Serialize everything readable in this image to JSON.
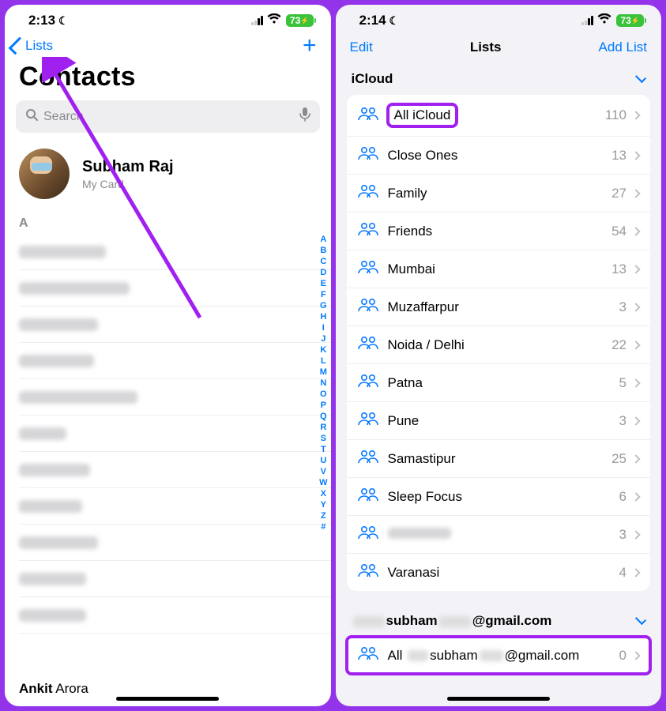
{
  "left": {
    "status": {
      "time": "2:13",
      "battery": "73"
    },
    "nav": {
      "back": "Lists"
    },
    "title": "Contacts",
    "search": {
      "placeholder": "Search"
    },
    "mycard": {
      "name": "Subham Raj",
      "sub": "My Card"
    },
    "section_letter": "A",
    "index": [
      "A",
      "B",
      "C",
      "D",
      "E",
      "F",
      "G",
      "H",
      "I",
      "J",
      "K",
      "L",
      "M",
      "N",
      "O",
      "P",
      "Q",
      "R",
      "S",
      "T",
      "U",
      "V",
      "W",
      "X",
      "Y",
      "Z",
      "#"
    ],
    "bottom_contact": {
      "first": "Ankit",
      "last": "Arora"
    }
  },
  "right": {
    "status": {
      "time": "2:14",
      "battery": "73"
    },
    "nav": {
      "edit": "Edit",
      "title": "Lists",
      "add": "Add List"
    },
    "sections": {
      "icloud": {
        "header": "iCloud",
        "rows": [
          {
            "label": "All iCloud",
            "count": "110",
            "highlight": true
          },
          {
            "label": "Close Ones",
            "count": "13"
          },
          {
            "label": "Family",
            "count": "27"
          },
          {
            "label": "Friends",
            "count": "54"
          },
          {
            "label": "Mumbai",
            "count": "13"
          },
          {
            "label": "Muzaffarpur",
            "count": "3"
          },
          {
            "label": "Noida / Delhi",
            "count": "22"
          },
          {
            "label": "Patna",
            "count": "5"
          },
          {
            "label": "Pune",
            "count": "3"
          },
          {
            "label": "Samastipur",
            "count": "25"
          },
          {
            "label": "Sleep Focus",
            "count": "6"
          },
          {
            "label": "",
            "count": "3",
            "blurred": true
          },
          {
            "label": "Varanasi",
            "count": "4"
          }
        ]
      },
      "gmail": {
        "header_prefix": "subham",
        "header_suffix": "@gmail.com",
        "row_prefix": "All",
        "row_mid": "subham",
        "row_suffix": "@gmail.com",
        "count": "0"
      }
    }
  }
}
